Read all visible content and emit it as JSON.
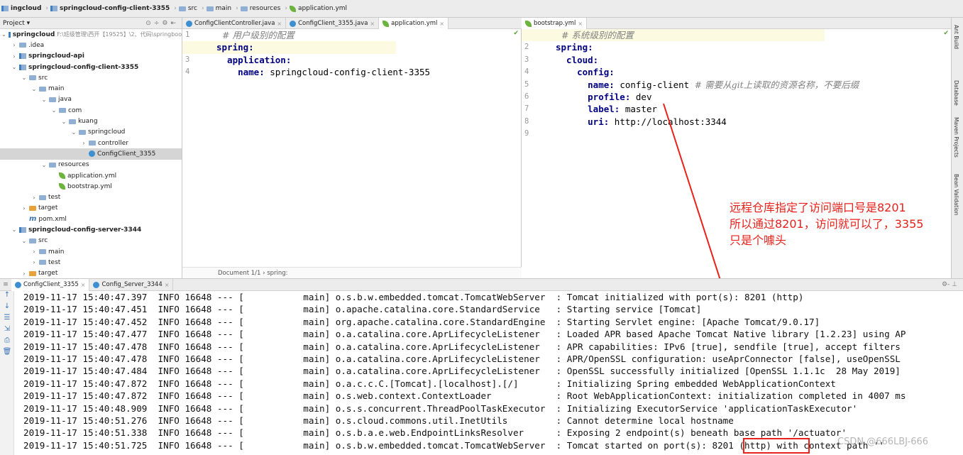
{
  "breadcrumb": [
    {
      "label": "ingcloud",
      "icon": "module-icon"
    },
    {
      "label": "springcloud-config-client-3355",
      "icon": "module-icon"
    },
    {
      "label": "src",
      "icon": "folder-icon"
    },
    {
      "label": "main",
      "icon": "folder-icon"
    },
    {
      "label": "resources",
      "icon": "folder-icon"
    },
    {
      "label": "application.yml",
      "icon": "yaml-leaf-icon"
    }
  ],
  "project_panel": {
    "title": "Project",
    "tree": [
      {
        "label": "springcloud",
        "path": "F:\\班级管理\\西开【19525】\\2、代码\\springboo",
        "indent": 0,
        "arrow": "v",
        "icon": "module-icon",
        "bold": true
      },
      {
        "label": ".idea",
        "indent": 1,
        "arrow": ">",
        "icon": "folder-icon"
      },
      {
        "label": "springcloud-api",
        "indent": 1,
        "arrow": ">",
        "icon": "module-icon",
        "bold": true
      },
      {
        "label": "springcloud-config-client-3355",
        "indent": 1,
        "arrow": "v",
        "icon": "module-icon",
        "bold": true
      },
      {
        "label": "src",
        "indent": 2,
        "arrow": "v",
        "icon": "folder-icon"
      },
      {
        "label": "main",
        "indent": 3,
        "arrow": "v",
        "icon": "folder-icon"
      },
      {
        "label": "java",
        "indent": 4,
        "arrow": "v",
        "icon": "folder-icon"
      },
      {
        "label": "com",
        "indent": 5,
        "arrow": "v",
        "icon": "package-icon"
      },
      {
        "label": "kuang",
        "indent": 6,
        "arrow": "v",
        "icon": "package-icon"
      },
      {
        "label": "springcloud",
        "indent": 7,
        "arrow": "v",
        "icon": "package-icon"
      },
      {
        "label": "controller",
        "indent": 8,
        "arrow": ">",
        "icon": "package-icon"
      },
      {
        "label": "ConfigClient_3355",
        "indent": 8,
        "arrow": "",
        "icon": "spring-class-icon",
        "selected": true
      },
      {
        "label": "resources",
        "indent": 4,
        "arrow": "v",
        "icon": "folder-icon"
      },
      {
        "label": "application.yml",
        "indent": 5,
        "arrow": "",
        "icon": "yaml-leaf-icon"
      },
      {
        "label": "bootstrap.yml",
        "indent": 5,
        "arrow": "",
        "icon": "yaml-leaf-icon"
      },
      {
        "label": "test",
        "indent": 3,
        "arrow": ">",
        "icon": "folder-icon"
      },
      {
        "label": "target",
        "indent": 2,
        "arrow": ">",
        "icon": "orange-folder-icon"
      },
      {
        "label": "pom.xml",
        "indent": 2,
        "arrow": "",
        "icon": "maven-icon"
      },
      {
        "label": "springcloud-config-server-3344",
        "indent": 1,
        "arrow": "v",
        "icon": "module-icon",
        "bold": true
      },
      {
        "label": "src",
        "indent": 2,
        "arrow": "v",
        "icon": "folder-icon"
      },
      {
        "label": "main",
        "indent": 3,
        "arrow": ">",
        "icon": "folder-icon"
      },
      {
        "label": "test",
        "indent": 3,
        "arrow": ">",
        "icon": "folder-icon"
      },
      {
        "label": "target",
        "indent": 2,
        "arrow": ">",
        "icon": "orange-folder-icon"
      }
    ]
  },
  "editor_tabs_left": [
    {
      "label": "ConfigClientController.java",
      "active": false
    },
    {
      "label": "ConfigClient_3355.java",
      "active": false
    },
    {
      "label": "application.yml",
      "active": true
    }
  ],
  "editor_tabs_right": [
    {
      "label": "bootstrap.yml",
      "active": true
    }
  ],
  "editor_left": {
    "lines": [
      {
        "n": "1",
        "segs": [
          {
            "t": "  # 用户级别的配置",
            "c": "c"
          }
        ],
        "hl": false
      },
      {
        "n": "2",
        "segs": [
          {
            "t": "spring:",
            "c": "k"
          }
        ],
        "hl": true
      },
      {
        "n": "3",
        "segs": [
          {
            "t": "  application:",
            "c": "k"
          }
        ],
        "hl": false
      },
      {
        "n": "4",
        "segs": [
          {
            "t": "    name: ",
            "c": "k"
          },
          {
            "t": "springcloud-config-client-3355",
            "c": "v"
          }
        ],
        "hl": false
      }
    ],
    "status": "Document 1/1  ›  spring:"
  },
  "editor_right": {
    "lines": [
      {
        "n": "1",
        "segs": [
          {
            "t": "  # 系统级别的配置",
            "c": "c"
          }
        ],
        "hl": true
      },
      {
        "n": "2",
        "segs": [
          {
            "t": "spring:",
            "c": "k"
          }
        ],
        "hl": false
      },
      {
        "n": "3",
        "segs": [
          {
            "t": "  cloud:",
            "c": "k"
          }
        ],
        "hl": false
      },
      {
        "n": "4",
        "segs": [
          {
            "t": "    config:",
            "c": "k"
          }
        ],
        "hl": false
      },
      {
        "n": "5",
        "segs": [
          {
            "t": "      name: ",
            "c": "k"
          },
          {
            "t": "config-client ",
            "c": "v"
          },
          {
            "t": "# 需要从git上读取的资源名称，不要后缀",
            "c": "c"
          }
        ],
        "hl": false
      },
      {
        "n": "6",
        "segs": [
          {
            "t": "      profile: ",
            "c": "k"
          },
          {
            "t": "dev",
            "c": "v"
          }
        ],
        "hl": false
      },
      {
        "n": "7",
        "segs": [
          {
            "t": "      label: ",
            "c": "k"
          },
          {
            "t": "master",
            "c": "v"
          }
        ],
        "hl": false
      },
      {
        "n": "8",
        "segs": [
          {
            "t": "      uri: ",
            "c": "k"
          },
          {
            "t": "http://localhost:3344",
            "c": "v"
          }
        ],
        "hl": false
      },
      {
        "n": "9",
        "segs": [],
        "hl": false
      }
    ]
  },
  "right_tool_strip": [
    "Ant Build",
    "Database",
    "Maven Projects",
    "Bean Validation"
  ],
  "annotation": {
    "text": "远程仓库指定了访问端口号是8201\n所以通过8201，访问就可以了，3355\n只是个噱头",
    "color": "#e8211a"
  },
  "run_tabs": [
    {
      "label": "ConfigClient_3355"
    },
    {
      "label": "Config_Server_3344"
    }
  ],
  "console": {
    "lines": [
      "2019-11-17 15:40:47.397  INFO 16648 --- [           main] o.s.b.w.embedded.tomcat.TomcatWebServer  : Tomcat initialized with port(s): 8201 (http)",
      "2019-11-17 15:40:47.451  INFO 16648 --- [           main] o.apache.catalina.core.StandardService   : Starting service [Tomcat]",
      "2019-11-17 15:40:47.452  INFO 16648 --- [           main] org.apache.catalina.core.StandardEngine  : Starting Servlet engine: [Apache Tomcat/9.0.17]",
      "2019-11-17 15:40:47.477  INFO 16648 --- [           main] o.a.catalina.core.AprLifecycleListener   : Loaded APR based Apache Tomcat Native library [1.2.23] using AP",
      "2019-11-17 15:40:47.478  INFO 16648 --- [           main] o.a.catalina.core.AprLifecycleListener   : APR capabilities: IPv6 [true], sendfile [true], accept filters",
      "2019-11-17 15:40:47.478  INFO 16648 --- [           main] o.a.catalina.core.AprLifecycleListener   : APR/OpenSSL configuration: useAprConnector [false], useOpenSSL",
      "2019-11-17 15:40:47.484  INFO 16648 --- [           main] o.a.catalina.core.AprLifecycleListener   : OpenSSL successfully initialized [OpenSSL 1.1.1c  28 May 2019]",
      "2019-11-17 15:40:47.872  INFO 16648 --- [           main] o.a.c.c.C.[Tomcat].[localhost].[/]       : Initializing Spring embedded WebApplicationContext",
      "2019-11-17 15:40:47.872  INFO 16648 --- [           main] o.s.web.context.ContextLoader            : Root WebApplicationContext: initialization completed in 4007 ms",
      "2019-11-17 15:40:48.909  INFO 16648 --- [           main] o.s.s.concurrent.ThreadPoolTaskExecutor  : Initializing ExecutorService 'applicationTaskExecutor'",
      "2019-11-17 15:40:51.276  INFO 16648 --- [           main] o.s.cloud.commons.util.InetUtils         : Cannot determine local hostname",
      "2019-11-17 15:40:51.338  INFO 16648 --- [           main] o.s.b.a.e.web.EndpointLinksResolver      : Exposing 2 endpoint(s) beneath base path '/actuator'",
      "2019-11-17 15:40:51.725  INFO 16648 --- [           main] o.s.b.w.embedded.tomcat.TomcatWebServer  : Tomcat started on port(s): 8201 (http) with context path ''"
    ]
  },
  "watermark": "CSDN @666LBJ-666"
}
